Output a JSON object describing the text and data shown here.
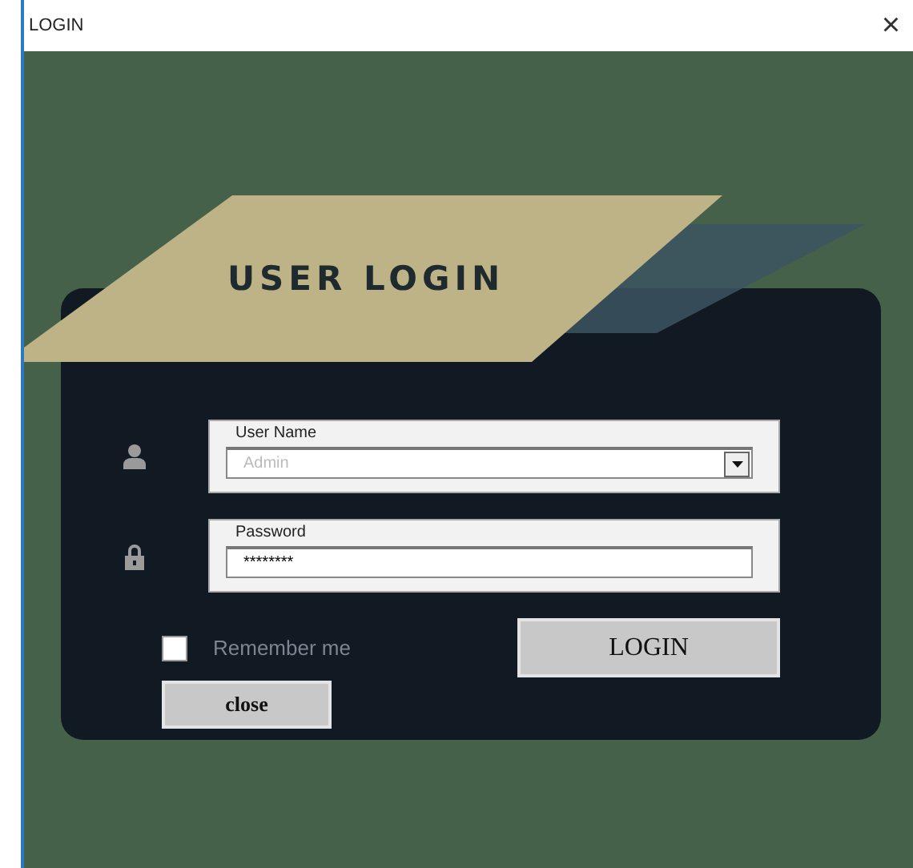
{
  "window": {
    "title": "LOGIN",
    "close": "×"
  },
  "banner": {
    "title": "USER LOGIN"
  },
  "fields": [
    {
      "kind": "dropdown",
      "legend": "User Name",
      "placeholder": "Admin"
    },
    {
      "kind": "password",
      "legend": "Password",
      "value": "********"
    }
  ],
  "remember": {
    "label": "Remember me",
    "checked": false
  },
  "buttons": {
    "login": "LOGIN",
    "close": "close"
  }
}
